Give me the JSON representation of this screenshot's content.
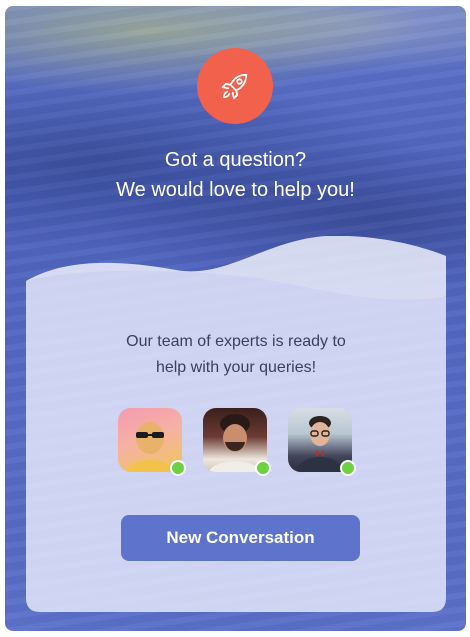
{
  "header": {
    "icon": "rocket-icon",
    "headline_line1": "Got a question?",
    "headline_line2": "We would love to help you!"
  },
  "card": {
    "text_line1": "Our team of experts is ready to",
    "text_line2": "help with your queries!",
    "agents": [
      {
        "status": "online"
      },
      {
        "status": "online"
      },
      {
        "status": "online"
      }
    ],
    "button_label": "New Conversation"
  },
  "colors": {
    "accent": "#f2614b",
    "button": "#5d73cc",
    "online": "#6ed142",
    "card_text": "#3a3f5c"
  }
}
